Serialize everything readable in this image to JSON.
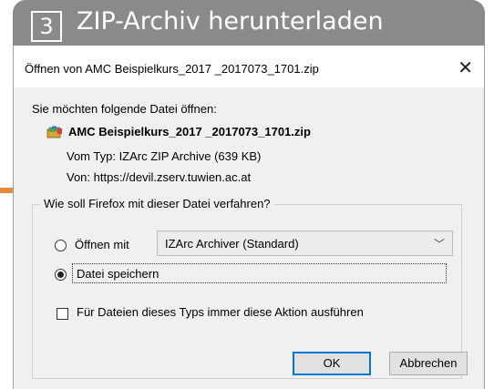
{
  "banner": {
    "step": "3",
    "title": "ZIP-Archiv herunterladen"
  },
  "dialog": {
    "title": "Öffnen von AMC Beispielkurs_2017 _2017073_1701.zip",
    "close_icon": "close-icon",
    "prompt": "Sie möchten folgende Datei öffnen:",
    "file_name": "AMC Beispielkurs_2017 _2017073_1701.zip",
    "file_icon": "archive-icon",
    "type_line": "Vom Typ: IZArc ZIP Archive (639 KB)",
    "from_line": "Von: https://devil.zserv.tuwien.ac.at",
    "group_legend": "Wie soll Firefox mit dieser Datei verfahren?",
    "open_with_label": "Öffnen mit",
    "open_with_selected": "IZArc Archiver (Standard)",
    "save_label": "Datei speichern",
    "always_label": "Für Dateien dieses Typs immer diese Aktion ausführen",
    "ok_label": "OK",
    "cancel_label": "Abbrechen",
    "selected_option": "Datei speichern",
    "always_checked": false
  },
  "colors": {
    "banner": "#8a8a8a",
    "marker": "#e8893a",
    "default_button_border": "#0078d7"
  }
}
